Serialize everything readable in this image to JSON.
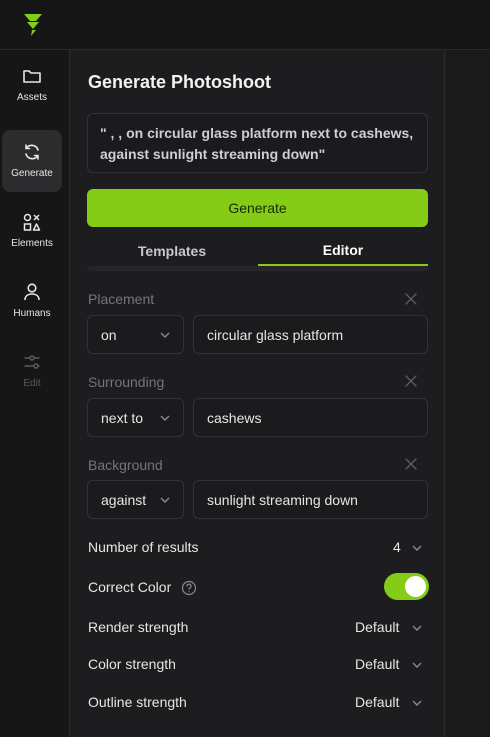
{
  "colors": {
    "accent": "#84cc16",
    "background": "#1d1d1f",
    "rail": "#161617"
  },
  "logo": {
    "icon": "brand-logo-icon"
  },
  "rail": {
    "items": [
      {
        "label": "Assets",
        "icon": "folder-icon",
        "active": false
      },
      {
        "label": "Generate",
        "icon": "refresh-icon",
        "active": true
      },
      {
        "label": "Elements",
        "icon": "shapes-icon",
        "active": false
      },
      {
        "label": "Humans",
        "icon": "person-icon",
        "active": false
      },
      {
        "label": "Edit",
        "icon": "sliders-icon",
        "disabled": true
      }
    ]
  },
  "panel": {
    "title": "Generate Photoshoot",
    "prompt": "\" , , on circular glass platform next to cashews, against sunlight streaming down\"",
    "generate_label": "Generate",
    "tabs": [
      {
        "label": "Templates",
        "active": false
      },
      {
        "label": "Editor",
        "active": true
      }
    ],
    "sections": [
      {
        "label": "Placement",
        "preposition": "on",
        "value": "circular glass platform"
      },
      {
        "label": "Surrounding",
        "preposition": "next to",
        "value": "cashews"
      },
      {
        "label": "Background",
        "preposition": "against",
        "value": "sunlight streaming down"
      }
    ],
    "settings": {
      "num_results": {
        "label": "Number of results",
        "value": "4"
      },
      "correct_color": {
        "label": "Correct Color",
        "enabled": true
      },
      "render_strength": {
        "label": "Render strength",
        "value": "Default"
      },
      "color_strength": {
        "label": "Color strength",
        "value": "Default"
      },
      "outline_strength": {
        "label": "Outline strength",
        "value": "Default"
      }
    }
  }
}
